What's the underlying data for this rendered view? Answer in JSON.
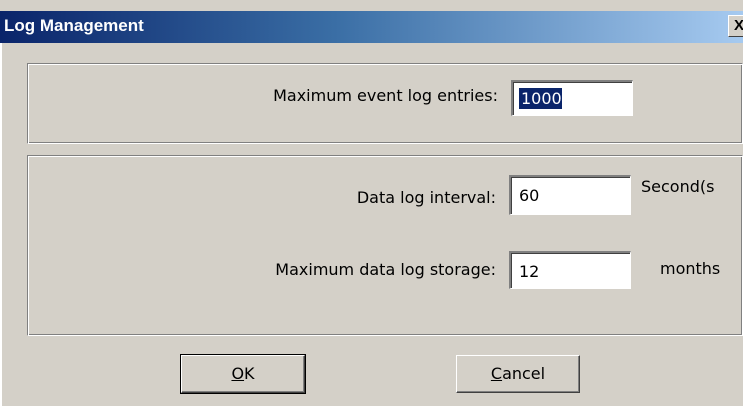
{
  "window": {
    "title": "Log Management",
    "close_glyph": "X"
  },
  "event_log": {
    "max_entries_label": "Maximum event log entries:",
    "max_entries_value": "1000"
  },
  "data_log": {
    "interval_label": "Data log interval:",
    "interval_value": "60",
    "interval_unit": "Second(s",
    "storage_label": "Maximum data log storage:",
    "storage_value": "12",
    "storage_unit": "months"
  },
  "buttons": {
    "ok": {
      "mnemonic": "O",
      "rest": "K"
    },
    "cancel": {
      "mnemonic": "C",
      "rest": "ancel"
    }
  },
  "colors": {
    "face": "#d4d0c8",
    "title_start": "#0a246a",
    "title_end": "#a6caf0",
    "selection": "#0a246a"
  }
}
